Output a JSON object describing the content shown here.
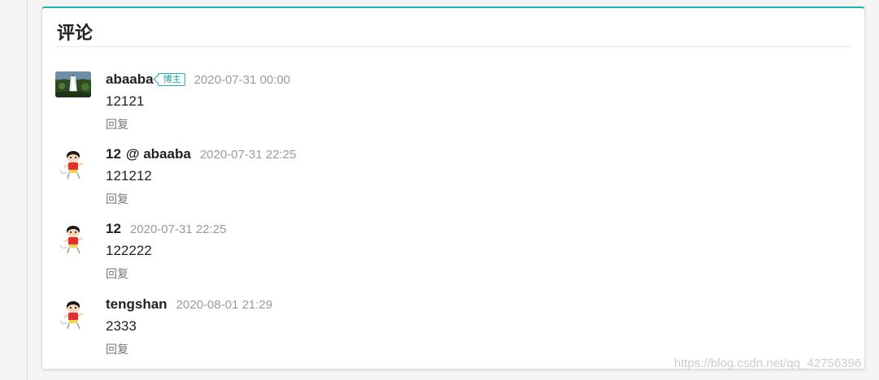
{
  "card": {
    "title": "评论"
  },
  "comments": [
    {
      "author": "abaaba",
      "badge": "博主",
      "mention": "",
      "time": "2020-07-31 00:00",
      "text": "12121",
      "reply_label": "回复",
      "avatar_icon": "landscape-photo-avatar"
    },
    {
      "author": "12",
      "badge": "",
      "mention": "@ abaaba",
      "time": "2020-07-31 22:25",
      "text": "121212",
      "reply_label": "回复",
      "avatar_icon": "cartoon-boy-avatar"
    },
    {
      "author": "12",
      "badge": "",
      "mention": "",
      "time": "2020-07-31 22:25",
      "text": "122222",
      "reply_label": "回复",
      "avatar_icon": "cartoon-boy-avatar"
    },
    {
      "author": "tengshan",
      "badge": "",
      "mention": "",
      "time": "2020-08-01 21:29",
      "text": "2333",
      "reply_label": "回复",
      "avatar_icon": "cartoon-boy-avatar"
    }
  ],
  "watermark": "https://blog.csdn.net/qq_42756396",
  "colors": {
    "accent": "#22b2b0",
    "time_text": "#9a9a9a",
    "reply_text": "#777777"
  }
}
